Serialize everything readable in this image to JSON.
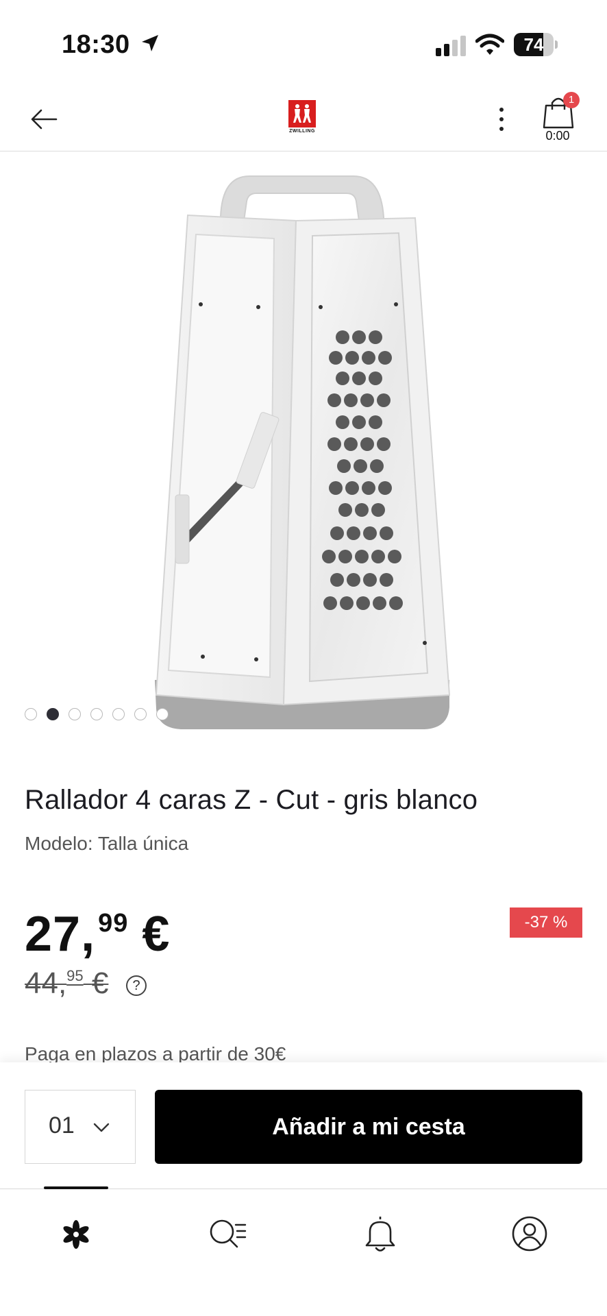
{
  "status_bar": {
    "time": "18:30",
    "battery": "74",
    "battery_level": 0.74
  },
  "header": {
    "brand": "ZWILLING",
    "cart_badge": "1",
    "cart_total": "0:00"
  },
  "carousel": {
    "total": 7,
    "active_index": 1
  },
  "product": {
    "title": "Rallador 4 caras Z - Cut - gris blanco",
    "model": "Modelo: Talla única",
    "price_int": "27,",
    "price_dec": "99",
    "currency": "€",
    "old_price_int": "44,",
    "old_price_dec": "95",
    "discount": "-37 %",
    "installments": "Paga en plazos a partir de 30€"
  },
  "cart_bar": {
    "quantity": "01",
    "add_label": "Añadir a mi cesta"
  },
  "colors": {
    "accent_red": "#e5484d",
    "button_black": "#000000",
    "logo_red": "#d81e1e"
  },
  "tabs": [
    {
      "icon": "flower-icon"
    },
    {
      "icon": "search-list-icon"
    },
    {
      "icon": "bell-icon"
    },
    {
      "icon": "user-icon"
    }
  ]
}
